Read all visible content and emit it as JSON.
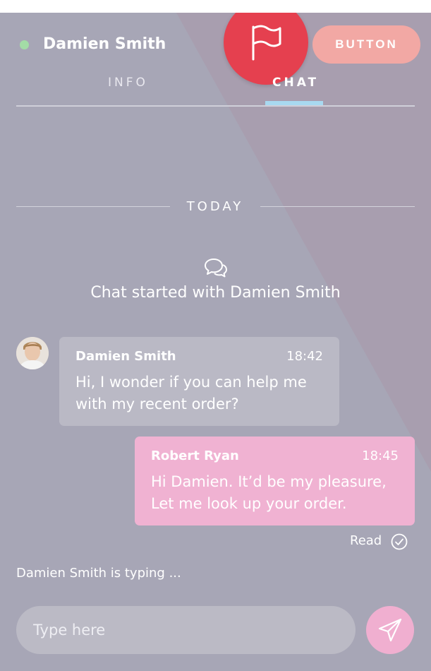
{
  "header": {
    "contact_name": "Damien Smith",
    "status": "online",
    "status_color": "#a3dca6",
    "flag_icon": "flag-icon",
    "flag_color": "#e5404f",
    "button_label": "BUTTON",
    "button_color": "#f2a8a4"
  },
  "tabs": [
    {
      "label": "INFO",
      "active": false
    },
    {
      "label": "CHAT",
      "active": true
    }
  ],
  "chat": {
    "date_separator": "TODAY",
    "started_text": "Chat started with Damien Smith",
    "messages": [
      {
        "sender": "Damien Smith",
        "time": "18:42",
        "text": "Hi, I wonder if you can help me with my recent order?",
        "direction": "incoming"
      },
      {
        "sender": "Robert Ryan",
        "time": "18:45",
        "text": "Hi Damien. It’d be my pleasure, Let me look up your order.",
        "direction": "outgoing"
      }
    ],
    "read_label": "Read",
    "typing_text": "Damien Smith is typing ..."
  },
  "composer": {
    "placeholder": "Type here",
    "send_icon": "send-icon"
  },
  "colors": {
    "panel": "#a7a6b6",
    "incoming_bubble": "#bab9c5",
    "outgoing_bubble": "#f0b2d2",
    "tab_indicator": "#a8d9f0"
  }
}
